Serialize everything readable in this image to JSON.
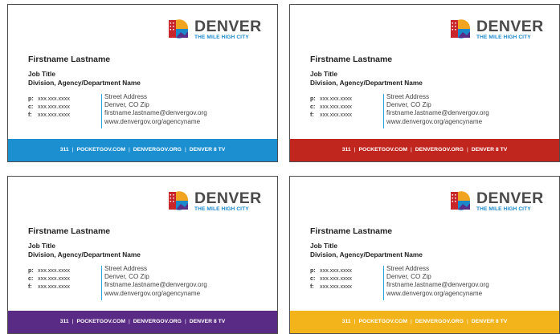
{
  "brand": {
    "word": "DENVER",
    "tagline": "THE MILE HIGH CITY",
    "colors": {
      "orange": "#f0a41f",
      "red": "#c8262a",
      "purple": "#5a2d86",
      "blue": "#1a88c9"
    }
  },
  "contact": {
    "name": "Firstname Lastname",
    "job_title": "Job Title",
    "division": "Division, Agency/Department Name",
    "phone_label": "p:",
    "cell_label": "c:",
    "fax_label": "f:",
    "phone": "xxx.xxx.xxxx",
    "cell": "xxx.xxx.xxxx",
    "fax": "xxx.xxx.xxxx",
    "street": "Street Address",
    "city": "Denver, CO Zip",
    "email": "firstname.lastname@denvergov.org",
    "website": "www.denvergov.org/agencyname"
  },
  "footer": {
    "item1": "311",
    "item2": "POCKETGOV.COM",
    "item3": "DENVERGOV.ORG",
    "item4": "DENVER 8 TV",
    "separator": "|"
  },
  "cards": [
    {
      "band_color": "#1b8fd0"
    },
    {
      "band_color": "#c0261e"
    },
    {
      "band_color": "#5a2b85"
    },
    {
      "band_color": "#f2b31b"
    }
  ]
}
